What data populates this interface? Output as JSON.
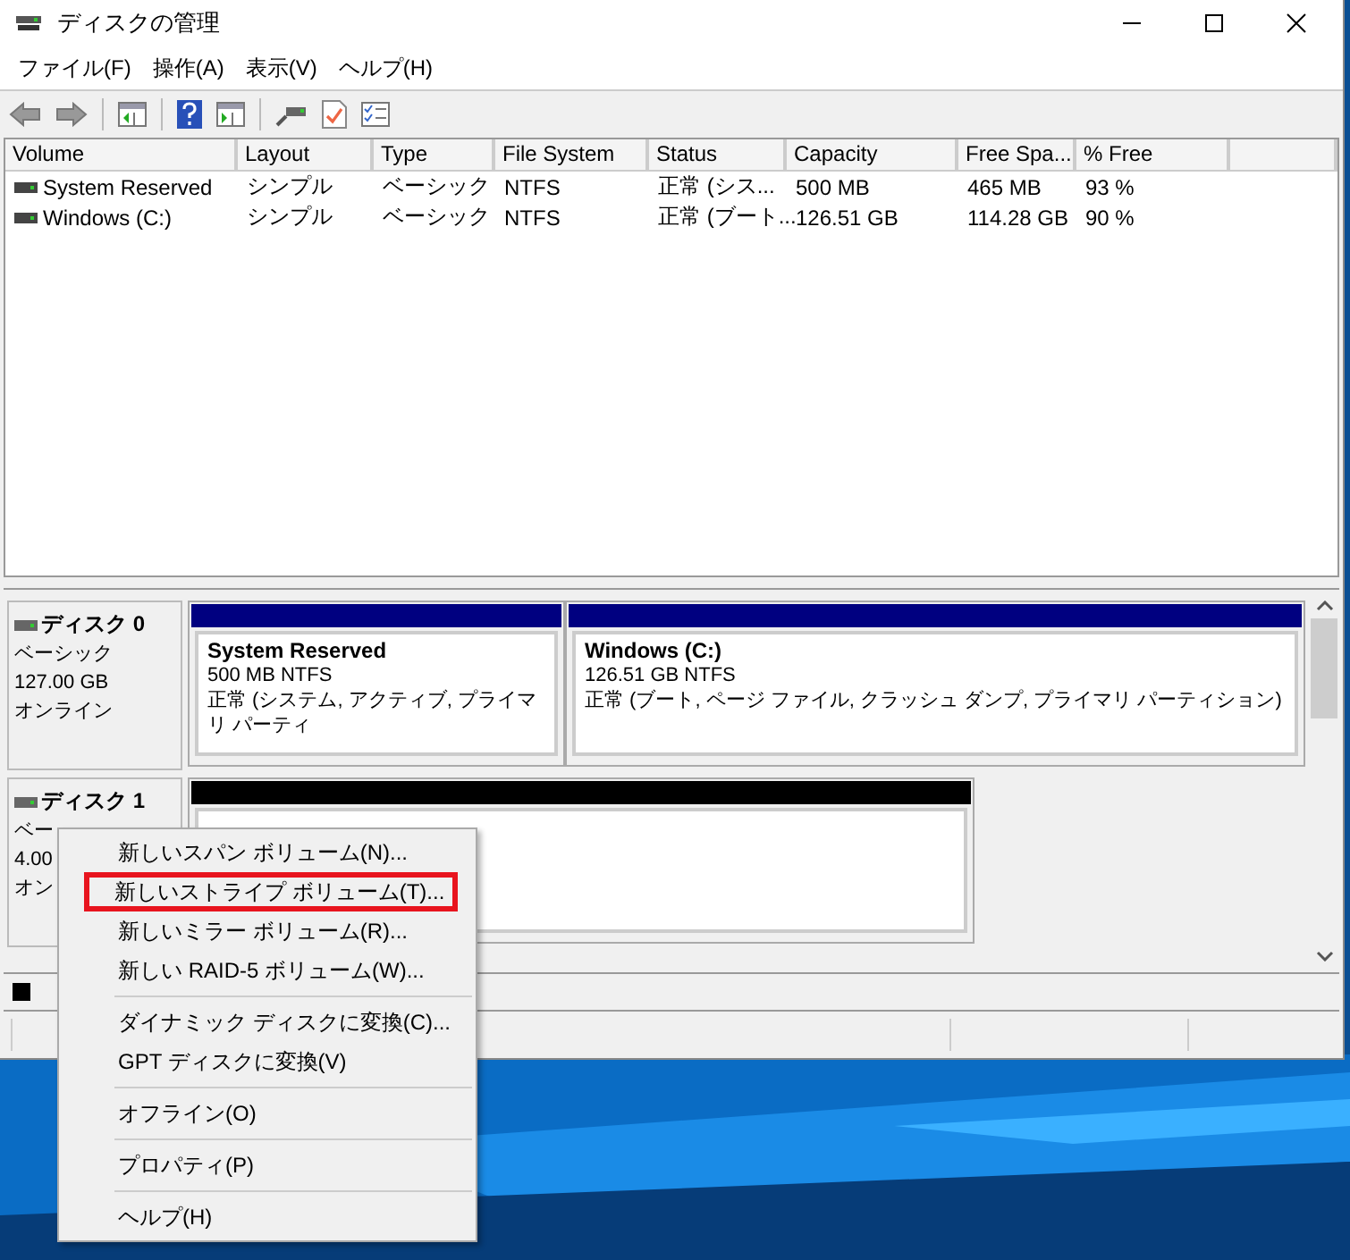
{
  "window": {
    "title": "ディスクの管理"
  },
  "menu_bar": [
    "ファイル(F)",
    "操作(A)",
    "表示(V)",
    "ヘルプ(H)"
  ],
  "volume_table": {
    "columns": [
      "Volume",
      "Layout",
      "Type",
      "File System",
      "Status",
      "Capacity",
      "Free Spa...",
      "% Free"
    ],
    "rows": [
      [
        "System Reserved",
        "シンプル",
        "ベーシック",
        "NTFS",
        "正常 (シス...",
        "500 MB",
        "465 MB",
        "93 %"
      ],
      [
        "Windows (C:)",
        "シンプル",
        "ベーシック",
        "NTFS",
        "正常 (ブート...",
        "126.51 GB",
        "114.28 GB",
        "90 %"
      ]
    ]
  },
  "disks": [
    {
      "name": "ディスク 0",
      "lines": [
        "ベーシック",
        "127.00 GB",
        "オンライン"
      ],
      "partitions": [
        {
          "kind": "primary",
          "title": "System Reserved",
          "size": "500 MB NTFS",
          "status": "正常 (システム, アクティブ, プライマリ パーティ"
        },
        {
          "kind": "primary",
          "title": "Windows  (C:)",
          "size": "126.51 GB NTFS",
          "status": "正常 (ブート, ページ ファイル, クラッシュ ダンプ, プライマリ パーティション)"
        }
      ]
    },
    {
      "name": "ディスク 1",
      "lines": [
        "ベー",
        "4.00",
        "オン"
      ],
      "partitions": [
        {
          "kind": "unallocated"
        }
      ]
    }
  ],
  "legend": [
    {
      "kind": "unallocated"
    }
  ],
  "context_menu": {
    "items": [
      {
        "kind": "item",
        "label": "新しいスパン ボリューム(N)...",
        "highlighted": false
      },
      {
        "kind": "item",
        "label": "新しいストライプ ボリューム(T)...",
        "highlighted": true
      },
      {
        "kind": "item",
        "label": "新しいミラー ボリューム(R)...",
        "highlighted": false
      },
      {
        "kind": "item",
        "label": "新しい RAID-5 ボリューム(W)...",
        "highlighted": false
      },
      {
        "kind": "separator"
      },
      {
        "kind": "item",
        "label": "ダイナミック ディスクに変換(C)...",
        "highlighted": false
      },
      {
        "kind": "item",
        "label": "GPT ディスクに変換(V)",
        "highlighted": false
      },
      {
        "kind": "separator"
      },
      {
        "kind": "item",
        "label": "オフライン(O)",
        "highlighted": false
      },
      {
        "kind": "separator"
      },
      {
        "kind": "item",
        "label": "プロパティ(P)",
        "highlighted": false
      },
      {
        "kind": "separator"
      },
      {
        "kind": "item",
        "label": "ヘルプ(H)",
        "highlighted": false
      }
    ]
  }
}
